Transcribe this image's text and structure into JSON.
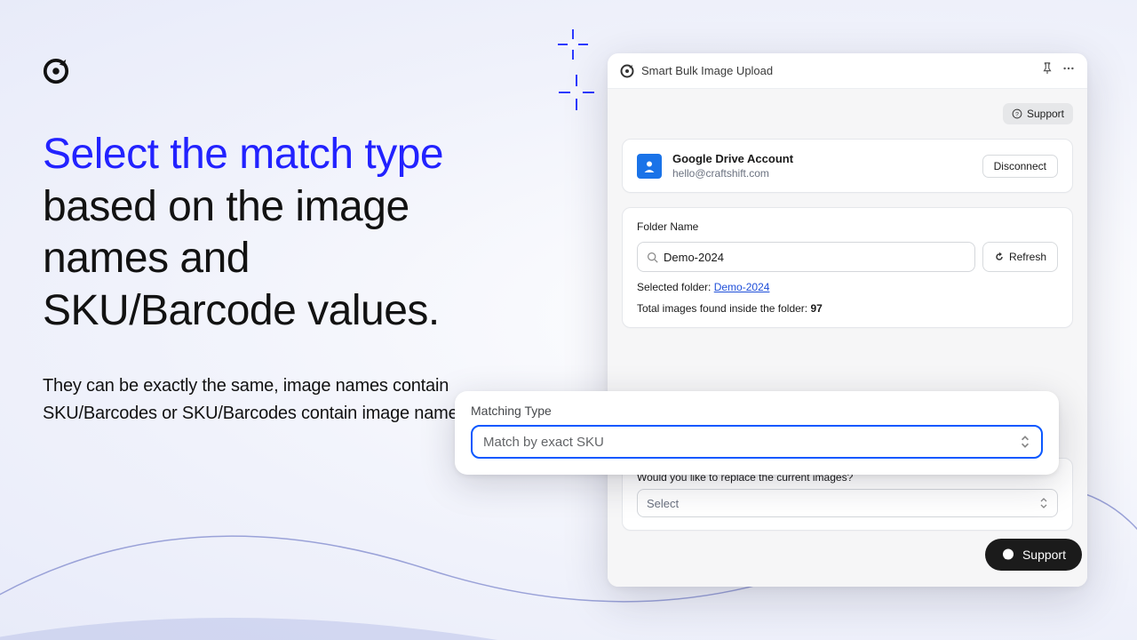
{
  "marketing": {
    "headline_accent": "Select the match type",
    "headline_rest": " based on the image names and SKU/Barcode values.",
    "subtext": "They can be exactly the same, image names contain SKU/Barcodes or SKU/Barcodes contain image names."
  },
  "app": {
    "title": "Smart Bulk Image Upload",
    "support_small": "Support",
    "account": {
      "title": "Google Drive Account",
      "email": "hello@craftshift.com",
      "disconnect": "Disconnect"
    },
    "folder": {
      "label": "Folder Name",
      "value": "Demo-2024",
      "refresh": "Refresh",
      "selected_prefix": "Selected folder: ",
      "selected_link": "Demo-2024",
      "found_prefix": "Total images found inside the folder: ",
      "found_count": "97"
    },
    "matching": {
      "label": "Matching Type",
      "value": "Match by exact SKU"
    },
    "replace": {
      "question": "Would you like to replace the current images?",
      "placeholder": "Select"
    }
  },
  "support_pill": "Support"
}
